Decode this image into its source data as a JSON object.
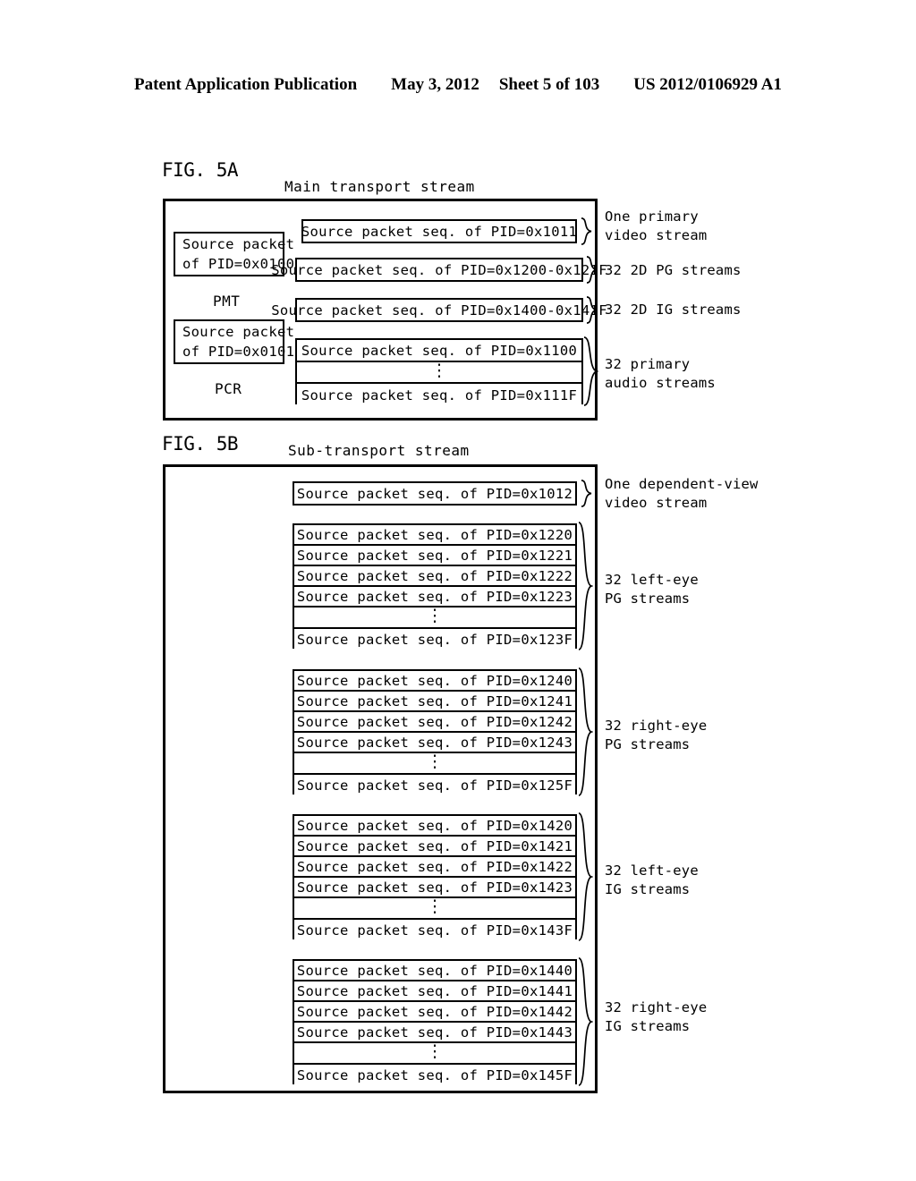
{
  "header": {
    "publication": "Patent Application Publication",
    "date": "May 3, 2012",
    "sheet": "Sheet 5 of 103",
    "number": "US 2012/0106929 A1"
  },
  "figures": [
    {
      "id": "fig5a",
      "label": "FIG. 5A",
      "caption": "Main transport stream",
      "side_boxes": [
        {
          "line1": "Source packet",
          "line2": "of PID=0x0100",
          "caption": "PMT"
        },
        {
          "line1": "Source packet",
          "line2": "of PID=0x0101",
          "caption": "PCR"
        }
      ],
      "groups": [
        {
          "name": "primary-video",
          "rows": [
            "Source packet seq. of PID=0x1011"
          ],
          "annotation": "One primary\nvideo stream"
        },
        {
          "name": "2d-pg",
          "rows": [
            "Source packet seq. of PID=0x1200-0x121F"
          ],
          "annotation": "32 2D PG streams"
        },
        {
          "name": "2d-ig",
          "rows": [
            "Source packet seq. of PID=0x1400-0x141F"
          ],
          "annotation": "32 2D IG streams"
        },
        {
          "name": "primary-audio",
          "rows": [
            "Source packet seq. of PID=0x1100",
            "⋮",
            "Source packet seq. of PID=0x111F"
          ],
          "annotation": "32 primary\naudio streams"
        }
      ]
    },
    {
      "id": "fig5b",
      "label": "FIG. 5B",
      "caption": "Sub-transport stream",
      "groups": [
        {
          "name": "dependent-view-video",
          "rows": [
            "Source packet seq. of PID=0x1012"
          ],
          "annotation": "One dependent-view\nvideo stream"
        },
        {
          "name": "left-eye-pg",
          "rows": [
            "Source packet seq. of PID=0x1220",
            "Source packet seq. of PID=0x1221",
            "Source packet seq. of PID=0x1222",
            "Source packet seq. of PID=0x1223",
            "⋮",
            "Source packet seq. of PID=0x123F"
          ],
          "annotation": "32 left-eye\nPG streams"
        },
        {
          "name": "right-eye-pg",
          "rows": [
            "Source packet seq. of PID=0x1240",
            "Source packet seq. of PID=0x1241",
            "Source packet seq. of PID=0x1242",
            "Source packet seq. of PID=0x1243",
            "⋮",
            "Source packet seq. of PID=0x125F"
          ],
          "annotation": "32 right-eye\nPG streams"
        },
        {
          "name": "left-eye-ig",
          "rows": [
            "Source packet seq. of PID=0x1420",
            "Source packet seq. of PID=0x1421",
            "Source packet seq. of PID=0x1422",
            "Source packet seq. of PID=0x1423",
            "⋮",
            "Source packet seq. of PID=0x143F"
          ],
          "annotation": "32 left-eye\nIG streams"
        },
        {
          "name": "right-eye-ig",
          "rows": [
            "Source packet seq. of PID=0x1440",
            "Source packet seq. of PID=0x1441",
            "Source packet seq. of PID=0x1442",
            "Source packet seq. of PID=0x1443",
            "⋮",
            "Source packet seq. of PID=0x145F"
          ],
          "annotation": "32 right-eye\nIG streams"
        }
      ]
    }
  ]
}
